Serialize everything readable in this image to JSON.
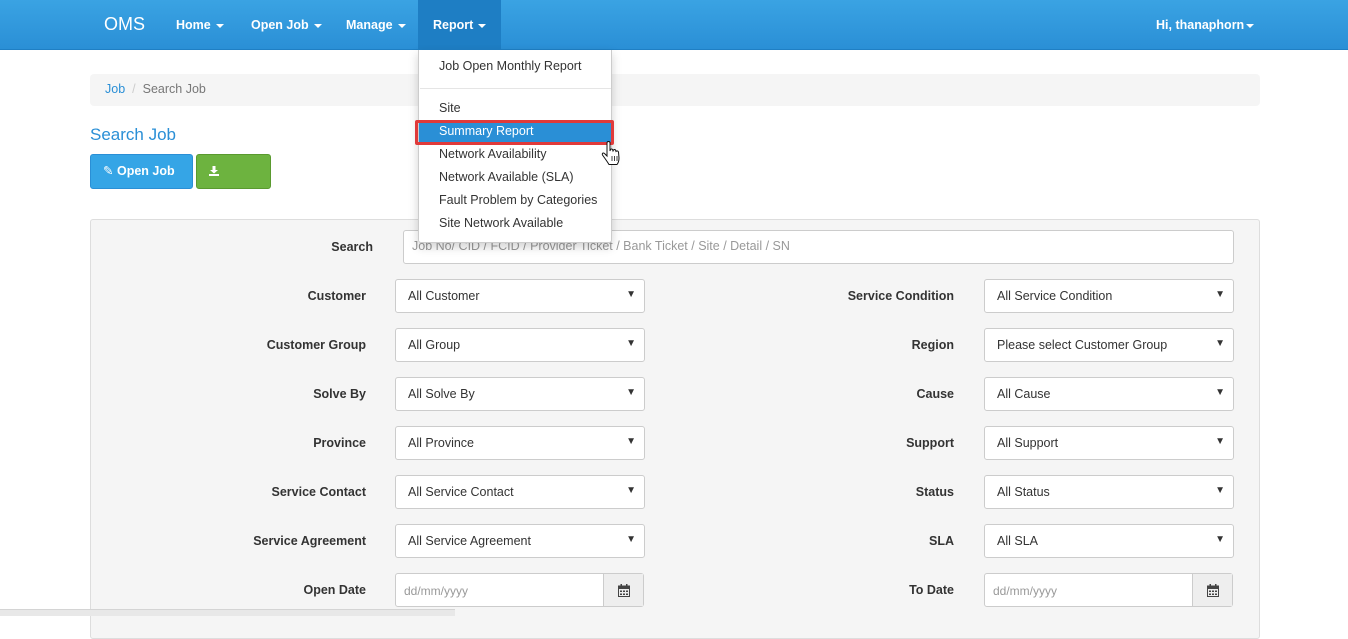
{
  "navbar": {
    "brand": "OMS",
    "items": [
      {
        "label": "Home"
      },
      {
        "label": "Open Job"
      },
      {
        "label": "Manage"
      },
      {
        "label": "Report"
      }
    ],
    "user": "Hi, thanaphorn"
  },
  "breadcrumb": {
    "link": "Job",
    "separator": "/",
    "current": "Search Job"
  },
  "page_title": "Search Job",
  "buttons": {
    "open_job": "Open Job",
    "export": "Export"
  },
  "report_menu": {
    "items": [
      "Job Open Monthly Report",
      "Site",
      "Summary Report",
      "Network Availability",
      "Network Available (SLA)",
      "Fault Problem by Categories",
      "Site Network Available"
    ],
    "highlighted": "Summary Report"
  },
  "form": {
    "search": {
      "label": "Search",
      "placeholder": "Job No/ CID / FCID / Provider Ticket / Bank Ticket / Site / Detail / SN"
    },
    "left": [
      {
        "label": "Customer",
        "value": "All Customer"
      },
      {
        "label": "Customer Group",
        "value": "All Group"
      },
      {
        "label": "Solve By",
        "value": "All Solve By"
      },
      {
        "label": "Province",
        "value": "All Province"
      },
      {
        "label": "Service Contact",
        "value": "All Service Contact"
      },
      {
        "label": "Service Agreement",
        "value": "All Service Agreement"
      }
    ],
    "right": [
      {
        "label": "Service Condition",
        "value": "All Service Condition"
      },
      {
        "label": "Region",
        "value": "Please select Customer Group"
      },
      {
        "label": "Cause",
        "value": "All Cause"
      },
      {
        "label": "Support",
        "value": "All Support"
      },
      {
        "label": "Status",
        "value": "All Status"
      },
      {
        "label": "SLA",
        "value": "All SLA"
      }
    ],
    "open_date": {
      "label": "Open Date",
      "placeholder": "dd/mm/yyyy"
    },
    "to_date": {
      "label": "To Date",
      "placeholder": "dd/mm/yyyy"
    }
  },
  "colors": {
    "navbar": "#2a8fd6",
    "highlight_border": "#e03a3a",
    "export_button": "#6db33f"
  },
  "icons": [
    "caret-down-icon",
    "pencil-icon",
    "download-icon",
    "calendar-icon",
    "hand-cursor-icon"
  ]
}
